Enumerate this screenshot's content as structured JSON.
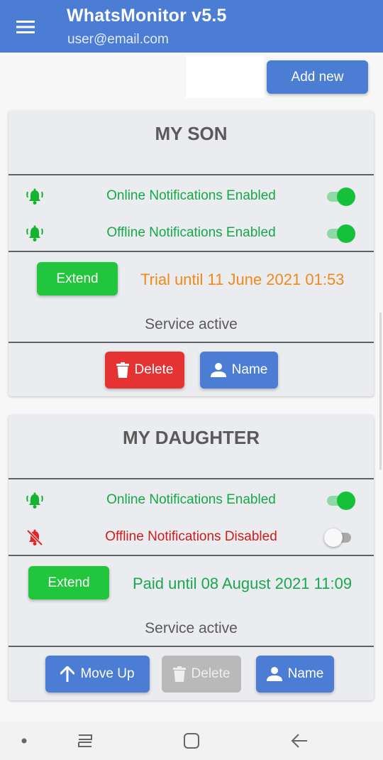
{
  "app": {
    "title": "WhatsMonitor v5.5",
    "account_email": "user@email.com"
  },
  "toolbar": {
    "add_new_label": "Add new"
  },
  "cards": [
    {
      "name": "MY SON",
      "online_notifications": {
        "label": "Online Notifications Enabled",
        "enabled": true
      },
      "offline_notifications": {
        "label": "Offline Notifications Enabled",
        "enabled": true
      },
      "extend_label": "Extend",
      "subscription_text": "Trial until 11 June 2021 01:53",
      "subscription_type": "trial",
      "service_status": "Service active",
      "actions": {
        "delete_label": "Delete",
        "name_label": "Name"
      }
    },
    {
      "name": "MY DAUGHTER",
      "online_notifications": {
        "label": "Online Notifications Enabled",
        "enabled": true
      },
      "offline_notifications": {
        "label": "Offline Notifications Disabled",
        "enabled": false
      },
      "extend_label": "Extend",
      "subscription_text": "Paid until 08 August 2021 11:09",
      "subscription_type": "paid",
      "service_status": "Service active",
      "actions": {
        "move_up_label": "Move Up",
        "delete_label": "Delete",
        "delete_disabled": true,
        "name_label": "Name"
      }
    }
  ],
  "icons": {
    "menu": "hamburger-menu-icon",
    "bell_on": "bell-ringing-icon",
    "bell_off": "bell-off-icon",
    "trash": "trash-icon",
    "person": "person-icon",
    "arrow_up": "arrow-up-icon"
  },
  "colors": {
    "primary": "#4a7dd3",
    "success_green": "#21c63c",
    "danger_red": "#e53232",
    "trial_orange": "#f08a18",
    "paid_green": "#18a850",
    "enabled_text": "#15a84a",
    "disabled_text": "#c81e1e"
  },
  "system_nav": {
    "items": [
      "dot",
      "recent-apps",
      "home",
      "back"
    ]
  }
}
